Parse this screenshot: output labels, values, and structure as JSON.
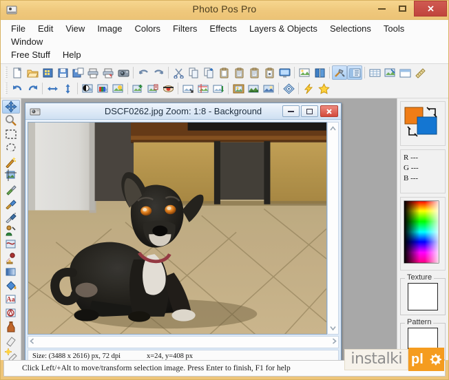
{
  "app": {
    "title": "Photo Pos Pro",
    "icon": "app-icon",
    "window_buttons": {
      "minimize": "minimize",
      "maximize": "maximize",
      "close": "close"
    }
  },
  "menubar": {
    "row1": [
      "File",
      "Edit",
      "View",
      "Image",
      "Colors",
      "Filters",
      "Effects",
      "Layers & Objects",
      "Selections",
      "Tools",
      "Window"
    ],
    "row2": [
      "Free Stuff",
      "Help"
    ]
  },
  "toolbar_row1": [
    {
      "name": "new-file-icon",
      "tip": "New"
    },
    {
      "name": "open-folder-icon",
      "tip": "Open"
    },
    {
      "name": "open-from-grid-icon",
      "tip": "Browse"
    },
    {
      "name": "save-icon",
      "tip": "Save"
    },
    {
      "name": "save-as-icon",
      "tip": "Save As"
    },
    {
      "name": "print-icon",
      "tip": "Print"
    },
    {
      "name": "print-preview-icon",
      "tip": "Print Preview"
    },
    {
      "name": "camera-icon",
      "tip": "Capture"
    },
    {
      "sep": true
    },
    {
      "name": "undo-icon",
      "tip": "Undo"
    },
    {
      "name": "redo-icon",
      "tip": "Redo"
    },
    {
      "sep": true
    },
    {
      "name": "cut-scissors-icon",
      "tip": "Cut"
    },
    {
      "name": "copy-icon",
      "tip": "Copy"
    },
    {
      "name": "copy-plus-icon",
      "tip": "Copy Merged"
    },
    {
      "name": "paste-icon",
      "tip": "Paste"
    },
    {
      "name": "paste-as-new-icon",
      "tip": "Paste As New"
    },
    {
      "name": "paste-into-icon",
      "tip": "Paste Into"
    },
    {
      "name": "paste-special-icon",
      "tip": "Paste Special"
    },
    {
      "name": "screen-icon",
      "tip": "Full Screen"
    },
    {
      "sep": true
    },
    {
      "name": "image-info-icon",
      "tip": "Image Info"
    },
    {
      "name": "book-icon",
      "tip": "Scripts"
    },
    {
      "sep": true
    },
    {
      "name": "tools-hammer-icon",
      "tip": "Tools Panel",
      "active": true
    },
    {
      "name": "properties-panel-icon",
      "tip": "Properties Panel",
      "active": true
    },
    {
      "sep": true
    },
    {
      "name": "grid-table-icon",
      "tip": "Grid"
    },
    {
      "name": "image-mask-icon",
      "tip": "Mask"
    },
    {
      "name": "frame-icon",
      "tip": "Frames"
    },
    {
      "name": "ruler-icon",
      "tip": "Rulers"
    }
  ],
  "toolbar_row2": [
    {
      "name": "rotate-left-icon",
      "tip": "Rotate Left"
    },
    {
      "name": "rotate-right-icon",
      "tip": "Rotate Right"
    },
    {
      "sep": true
    },
    {
      "name": "flip-horizontal-icon",
      "tip": "Flip Horizontal"
    },
    {
      "name": "flip-vertical-icon",
      "tip": "Flip Vertical"
    },
    {
      "sep": true
    },
    {
      "name": "brightness-contrast-icon",
      "tip": "Brightness / Contrast"
    },
    {
      "name": "color-balance-icon",
      "tip": "Color Balance"
    },
    {
      "name": "enhance-photo-icon",
      "tip": "Enhance Photo"
    },
    {
      "sep": true
    },
    {
      "name": "add-layer-icon",
      "tip": "Add Layer"
    },
    {
      "name": "layer-properties-icon",
      "tip": "Layer Properties"
    },
    {
      "name": "red-eye-icon",
      "tip": "Red Eye Removal"
    },
    {
      "sep": true
    },
    {
      "name": "resize-image-icon",
      "tip": "Resize Image"
    },
    {
      "name": "crop-image-icon",
      "tip": "Crop Image"
    },
    {
      "name": "batch-icon",
      "tip": "Batch"
    },
    {
      "sep": true
    },
    {
      "name": "picture-frame-icon",
      "tip": "Picture Frame"
    },
    {
      "name": "collage-icon",
      "tip": "Collage"
    },
    {
      "name": "photo-effect-icon",
      "tip": "Photo Effect"
    },
    {
      "sep": true
    },
    {
      "name": "diamond-info-icon",
      "tip": "Info"
    },
    {
      "sep": true
    },
    {
      "name": "lightning-icon",
      "tip": "Quick Fix"
    },
    {
      "name": "star-favorite-icon",
      "tip": "Favorites"
    }
  ],
  "toolbox": [
    {
      "name": "move-transform-tool",
      "selected": true
    },
    {
      "name": "zoom-tool"
    },
    {
      "name": "rectangular-select-tool"
    },
    {
      "name": "lasso-select-tool"
    },
    {
      "name": "magic-wand-tool"
    },
    {
      "name": "crop-tool"
    },
    {
      "name": "eyedropper-tool"
    },
    {
      "name": "paint-brush-tool"
    },
    {
      "name": "airbrush-tool"
    },
    {
      "name": "clone-brush-tool"
    },
    {
      "name": "retouch-brush-tool"
    },
    {
      "name": "clone-stamp-tool"
    },
    {
      "name": "gradient-tool"
    },
    {
      "name": "paint-bucket-tool"
    },
    {
      "name": "text-tool"
    },
    {
      "name": "vector-shape-tool"
    },
    {
      "name": "ink-bottle-tool"
    },
    {
      "name": "eraser-tool"
    },
    {
      "name": "light-effect-tool"
    }
  ],
  "right_panel": {
    "swap_colors": {
      "name": "foreground-background-swatch",
      "foreground": "#f07d16",
      "background": "#1476d2"
    },
    "rgb_readout": {
      "r": "R ---",
      "g": "G ---",
      "b": "B ---"
    },
    "color_picker": {
      "name": "color-spectrum-picker"
    },
    "texture": {
      "legend": "Texture",
      "swatch": "#ffffff"
    },
    "pattern": {
      "legend": "Pattern",
      "swatch": "#ffffff"
    }
  },
  "document": {
    "icon": "photo-document-icon",
    "title": "DSCF0262.jpg  Zoom: 1:8 - Background",
    "filename": "DSCF0262.jpg",
    "zoom": "Zoom: 1:8",
    "layer": "Background",
    "window_buttons": {
      "minimize": "minimize",
      "maximize": "maximize",
      "close": "close"
    },
    "status": {
      "size": "Size: (3488 x 2616) px, 72 dpi",
      "cursor": "x=24, y=408 px",
      "extra": ""
    },
    "scrollbars": {
      "vertical": {
        "up": "▲",
        "down": "▼"
      },
      "horizontal": {
        "left": "◀",
        "right": "▶"
      }
    },
    "image_subject": "black dog sitting on tiled floor"
  },
  "statusbar": {
    "hint": "Click Left/+Alt to move/transform selection image. Press Enter to finish, F1 for help"
  },
  "watermark": {
    "text": "instalki",
    "suffix": "pl"
  },
  "colors": {
    "titlebar": "#efc87c",
    "close_button": "#c0443c",
    "workspace": "#a8a8a8",
    "panel": "#f1f1f1",
    "doc_frame": "#cfe0f2"
  }
}
